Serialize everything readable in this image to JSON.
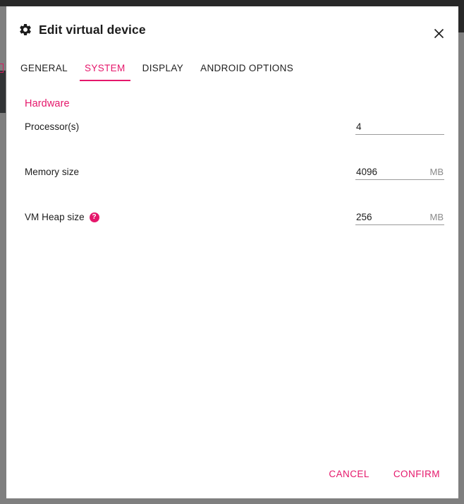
{
  "colors": {
    "accent_pink": "#e5176b",
    "text_primary": "#1c1c1c",
    "text_muted": "#8a8a8a",
    "field_underline": "#9b9b9b",
    "backdrop_dark": "#282828",
    "backdrop_gray": "#7f7f7f"
  },
  "header": {
    "icon": "gear-icon",
    "title": "Edit virtual device",
    "close_icon": "close-icon",
    "close_label": "✕"
  },
  "tabs": [
    {
      "label": "GENERAL",
      "active": false
    },
    {
      "label": "SYSTEM",
      "active": true
    },
    {
      "label": "DISPLAY",
      "active": false
    },
    {
      "label": "ANDROID OPTIONS",
      "active": false
    }
  ],
  "main": {
    "section_title": "Hardware",
    "fields": [
      {
        "label": "Processor(s)",
        "value": "4",
        "placeholder": "",
        "unit": "",
        "help_icon": false,
        "name": "processors"
      },
      {
        "label": "Memory size",
        "value": "4096",
        "placeholder": "",
        "unit": "MB",
        "help_icon": false,
        "name": "memory-size"
      },
      {
        "label": "VM Heap size",
        "value": "256",
        "placeholder": "",
        "unit": "MB",
        "help_icon": true,
        "help_glyph": "?",
        "name": "vm-heap-size"
      }
    ]
  },
  "footer": {
    "cancel_label": "CANCEL",
    "confirm_label": "CONFIRM"
  }
}
